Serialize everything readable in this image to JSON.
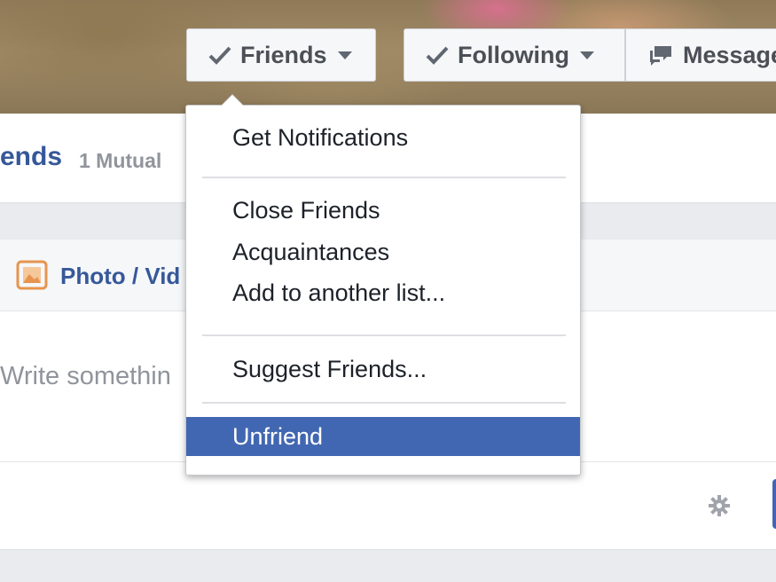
{
  "cover": {
    "friends_button": "Friends",
    "following_button": "Following",
    "message_button": "Message"
  },
  "profile": {
    "friends_heading": "ends",
    "mutual_count": "1 Mutual"
  },
  "composer": {
    "photo_video_label": "Photo / Vid",
    "placeholder": "Write somethin"
  },
  "friends_menu": {
    "items": [
      {
        "label": "Get Notifications"
      },
      {
        "label": "Close Friends"
      },
      {
        "label": "Acquaintances"
      },
      {
        "label": "Add to another list..."
      },
      {
        "label": "Suggest Friends..."
      },
      {
        "label": "Unfriend",
        "selected": true
      }
    ]
  },
  "colors": {
    "facebook_blue": "#4267b2",
    "link_blue": "#365899",
    "menu_text": "#1d2129",
    "muted_gray": "#90949c",
    "photo_icon_orange": "#e6944e"
  },
  "icons": [
    "check-icon",
    "caret-down-icon",
    "message-icon",
    "photo-icon",
    "gear-icon"
  ]
}
